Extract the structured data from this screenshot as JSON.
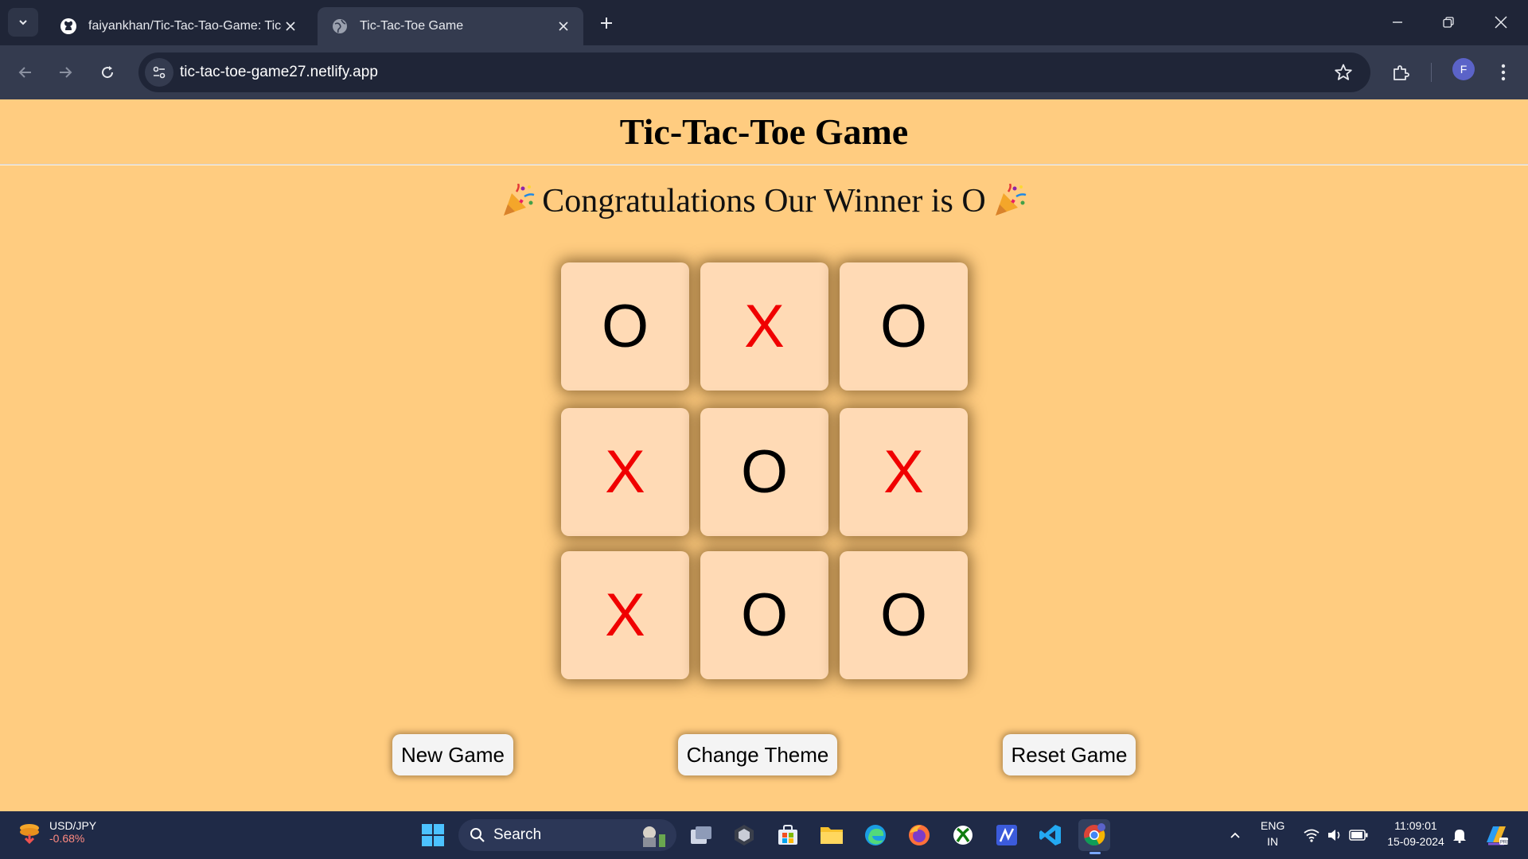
{
  "browser": {
    "tabs": [
      {
        "title": "faiyankhan/Tic-Tac-Tao-Game: Tic-",
        "icon": "github-icon",
        "active": false
      },
      {
        "title": "Tic-Tac-Toe Game",
        "icon": "globe-icon",
        "active": true
      }
    ],
    "url": "tic-tac-toe-game27.netlify.app",
    "profile_initial": "F"
  },
  "game": {
    "title": "Tic-Tac-Toe Game",
    "winner_message": "Congratulations Our Winner is O",
    "board": [
      [
        "O",
        "X",
        "O"
      ],
      [
        "X",
        "O",
        "X"
      ],
      [
        "X",
        "O",
        "O"
      ]
    ],
    "buttons": {
      "new_game": "New Game",
      "change_theme": "Change Theme",
      "reset_game": "Reset Game"
    },
    "colors": {
      "background": "#ffcc80",
      "cell": "#ffdab5",
      "x": "#f00000",
      "o": "#000000"
    }
  },
  "taskbar": {
    "ticker_symbol": "USD/JPY",
    "ticker_change": "-0.68%",
    "search_placeholder": "Search",
    "language": "ENG",
    "region": "IN",
    "time": "11:09:01",
    "date": "15-09-2024"
  }
}
